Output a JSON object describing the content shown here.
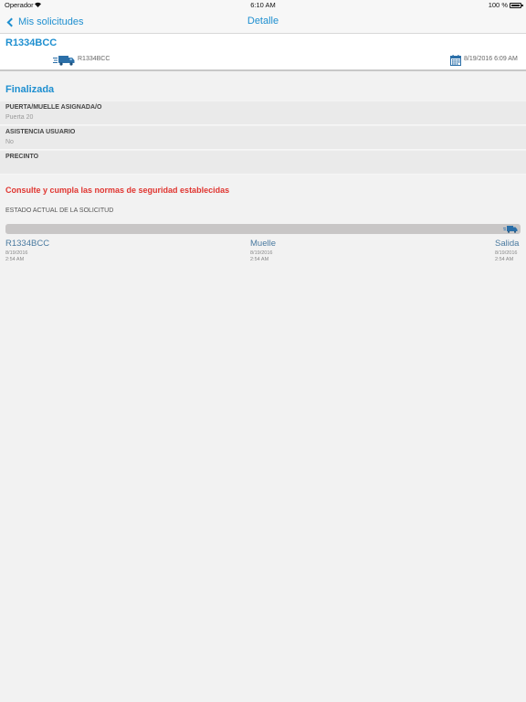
{
  "status_bar": {
    "carrier": "Operador",
    "time": "6:10 AM",
    "battery": "100 %"
  },
  "nav": {
    "back_label": "Mis solicitudes",
    "title": "Detalle"
  },
  "header": {
    "plate": "R1334BCC",
    "truck_plate": "R1334BCC",
    "date": "8/19/2016 6:09 AM"
  },
  "status": "Finalizada",
  "details": [
    {
      "label": "PUERTA/MUELLE ASIGNADA/O",
      "value": "Puerta 20"
    },
    {
      "label": "ASISTENCIA USUARIO",
      "value": "No"
    },
    {
      "label": "PRECINTO",
      "value": ""
    }
  ],
  "warning": "Consulte y cumpla las normas de seguridad establecidas",
  "progress": {
    "title": "ESTADO ACTUAL DE LA SOLICITUD",
    "completion": 1.0,
    "steps": [
      {
        "name": "R1334BCC",
        "date": "8/19/2016",
        "time": "2:54 AM"
      },
      {
        "name": "Muelle",
        "date": "8/19/2016",
        "time": "2:54 AM"
      },
      {
        "name": "Salida",
        "date": "8/19/2016",
        "time": "2:54 AM"
      }
    ]
  },
  "colors": {
    "accent": "#1e8fd0",
    "warning": "#e03530",
    "step_label": "#4a7aa0",
    "background": "#f2f2f2"
  },
  "icons": {
    "back": "chevron-left-icon",
    "wifi": "wifi-icon",
    "battery": "battery-icon",
    "truck": "truck-icon",
    "calendar": "calendar-icon"
  }
}
